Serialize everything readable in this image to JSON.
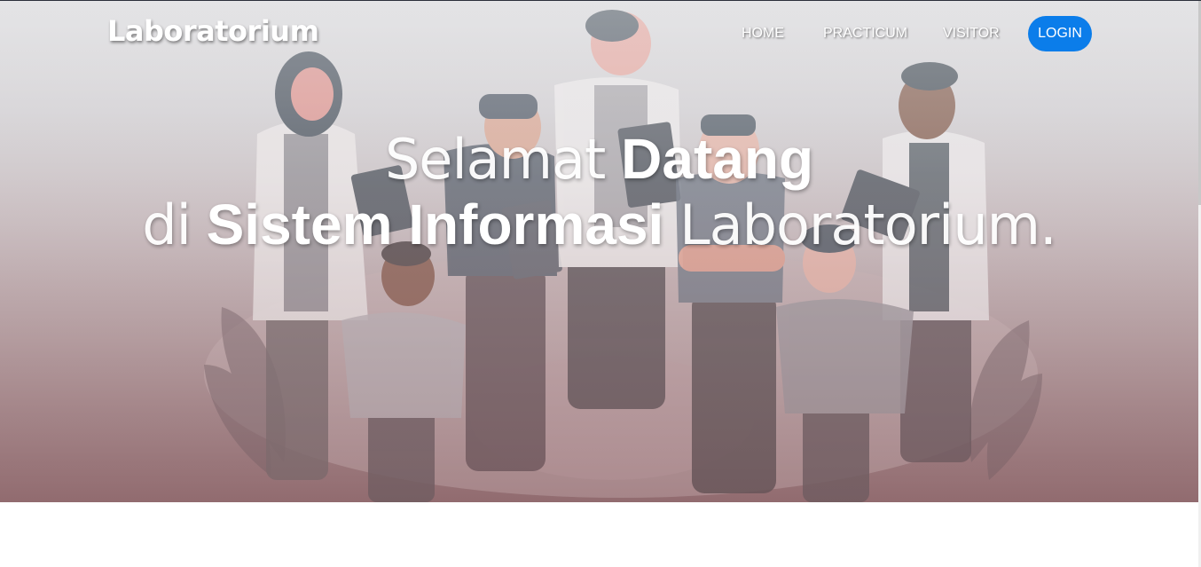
{
  "navbar": {
    "brand": "Laboratorium",
    "links": [
      "HOME",
      "PRACTICUM",
      "VISITOR"
    ],
    "login_label": "LOGIN"
  },
  "hero": {
    "line1_light": "Selamat",
    "line1_bold": "Datang",
    "line2_light_a": "di",
    "line2_bold": "Sistem Informasi",
    "line2_light_b": "Laboratorium."
  },
  "colors": {
    "login_button": "#0b7dea",
    "hero_top": "#e4e4e6",
    "hero_bottom": "#8f6a6e"
  },
  "icons": [
    "doctor-team-illustration"
  ]
}
